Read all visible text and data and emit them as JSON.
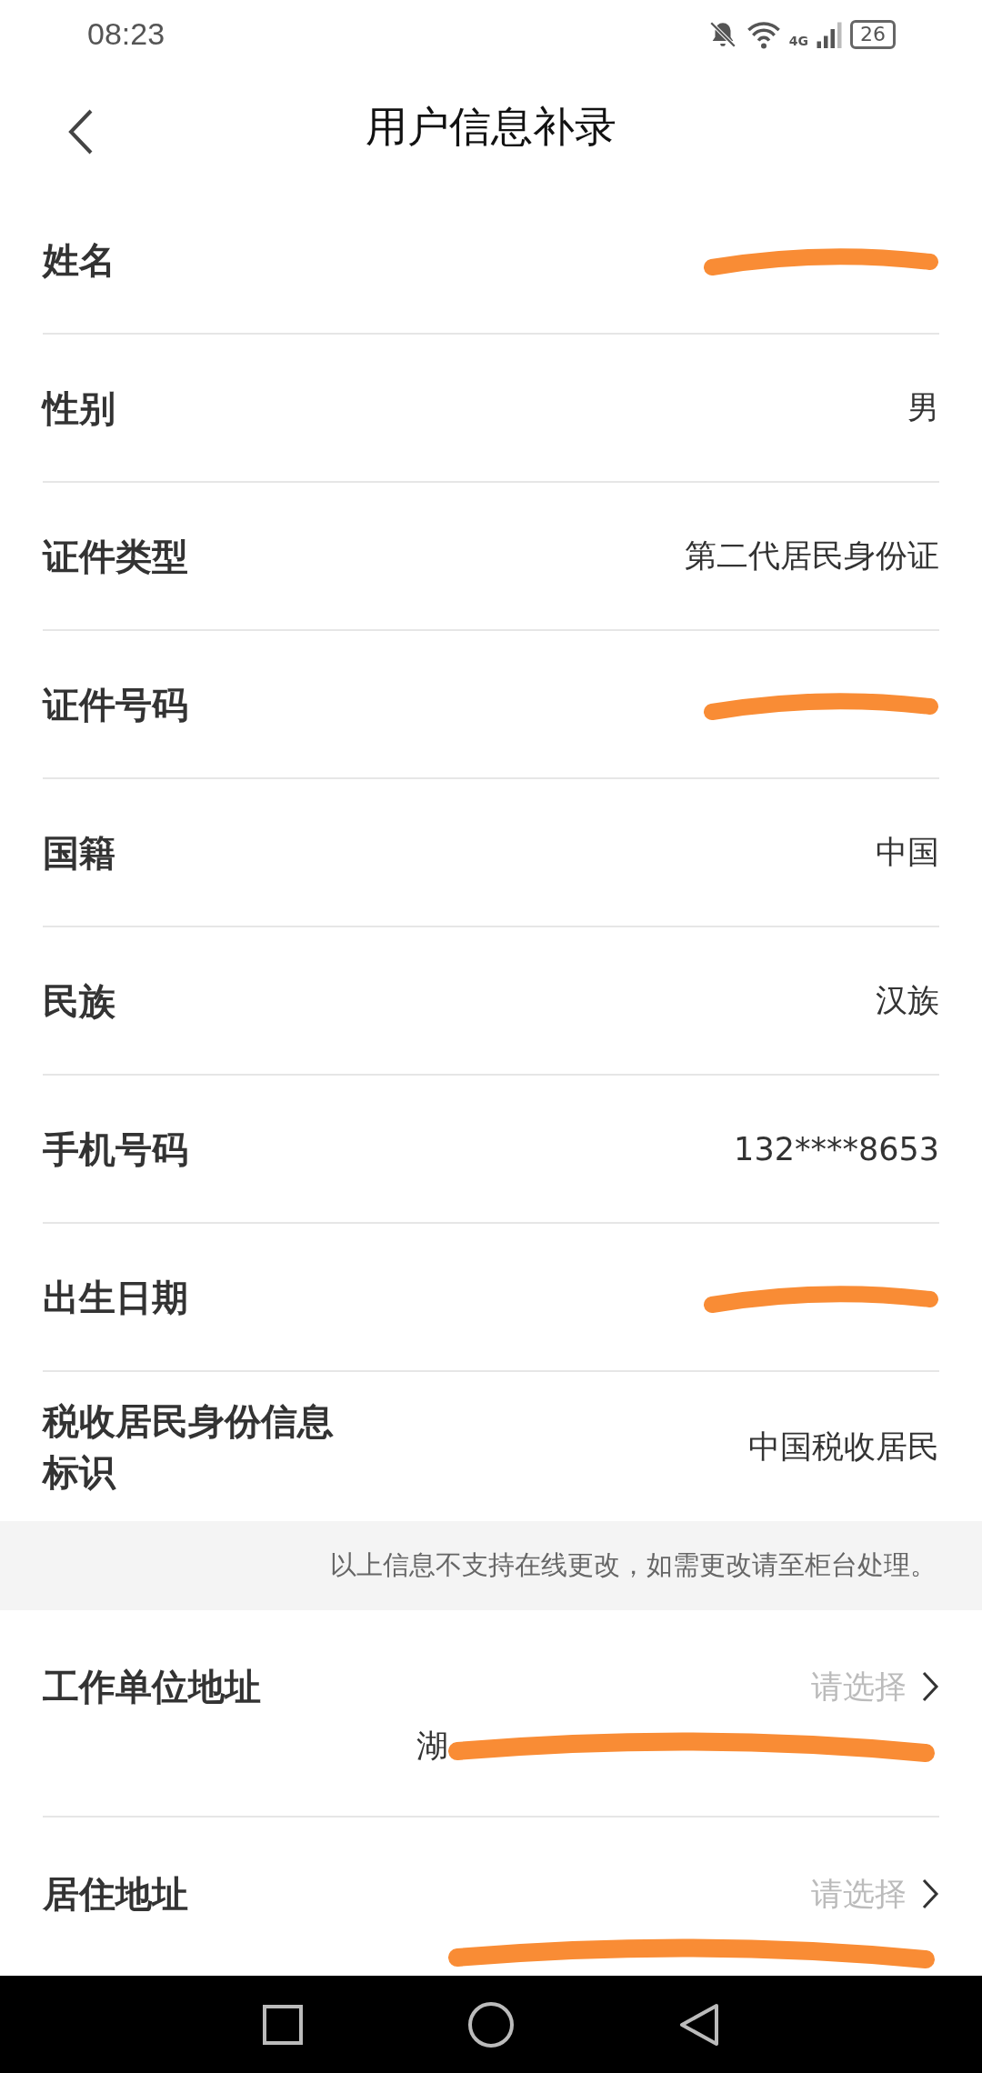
{
  "status_bar": {
    "time": "08:23",
    "network": "4G",
    "battery": "26"
  },
  "header": {
    "title": "用户信息补录"
  },
  "fields": [
    {
      "label": "姓名",
      "redacted": true
    },
    {
      "label": "性别",
      "value": "男",
      "redacted": false
    },
    {
      "label": "证件类型",
      "value": "第二代居民身份证",
      "redacted": false
    },
    {
      "label": "证件号码",
      "redacted": true
    },
    {
      "label": "国籍",
      "value": "中国",
      "redacted": false
    },
    {
      "label": "民族",
      "value": "汉族",
      "redacted": false
    },
    {
      "label": "手机号码",
      "value": "132****8653",
      "redacted": false
    },
    {
      "label": "出生日期",
      "redacted": true
    },
    {
      "label": "税收居民身份信息标识",
      "value": "中国税收居民",
      "redacted": false
    }
  ],
  "notice": "以上信息不支持在线更改，如需更改请至柜台处理。",
  "address_fields": [
    {
      "label": "工作单位地址",
      "placeholder": "请选择",
      "value": "湖",
      "redacted": true
    },
    {
      "label": "居住地址",
      "placeholder": "请选择",
      "redacted": true
    }
  ]
}
